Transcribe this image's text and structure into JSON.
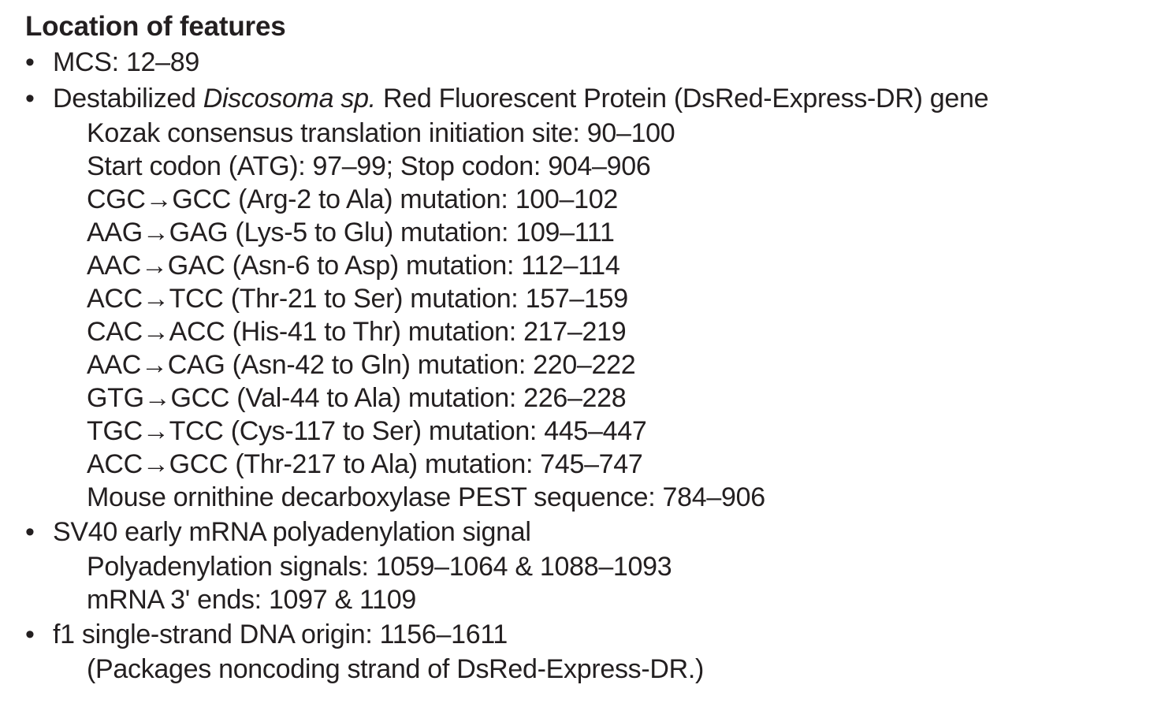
{
  "heading": "Location of features",
  "bullet_glyph": "•",
  "features": {
    "mcs": {
      "label": "MCS: 12–89"
    },
    "dsred": {
      "prefix": "Destabilized ",
      "italic": "Discosoma sp.",
      "suffix": " Red Fluorescent Protein (DsRed-Express-DR) gene",
      "sub_items": [
        "Kozak consensus translation initiation site: 90–100",
        "Start codon (ATG): 97–99;  Stop codon: 904–906",
        "CGC→GCC (Arg-2 to Ala) mutation: 100–102",
        "AAG→GAG (Lys-5 to Glu) mutation: 109–111",
        "AAC→GAC (Asn-6 to Asp) mutation: 112–114",
        "ACC→TCC (Thr-21 to Ser) mutation: 157–159",
        "CAC→ACC (His-41 to Thr) mutation: 217–219",
        "AAC→CAG (Asn-42 to Gln) mutation: 220–222",
        "GTG→GCC (Val-44 to Ala) mutation: 226–228",
        "TGC→TCC (Cys-117 to Ser) mutation: 445–447",
        "ACC→GCC (Thr-217 to Ala) mutation: 745–747",
        "Mouse ornithine decarboxylase PEST sequence: 784–906"
      ]
    },
    "sv40": {
      "label": "SV40 early mRNA polyadenylation signal",
      "sub_items": [
        "Polyadenylation signals: 1059–1064 & 1088–1093",
        "mRNA 3' ends: 1097 & 1109"
      ]
    },
    "f1": {
      "label": "f1 single-strand DNA origin: 1156–1611",
      "sub_items": [
        "(Packages noncoding strand of DsRed-Express-DR.)"
      ]
    }
  }
}
